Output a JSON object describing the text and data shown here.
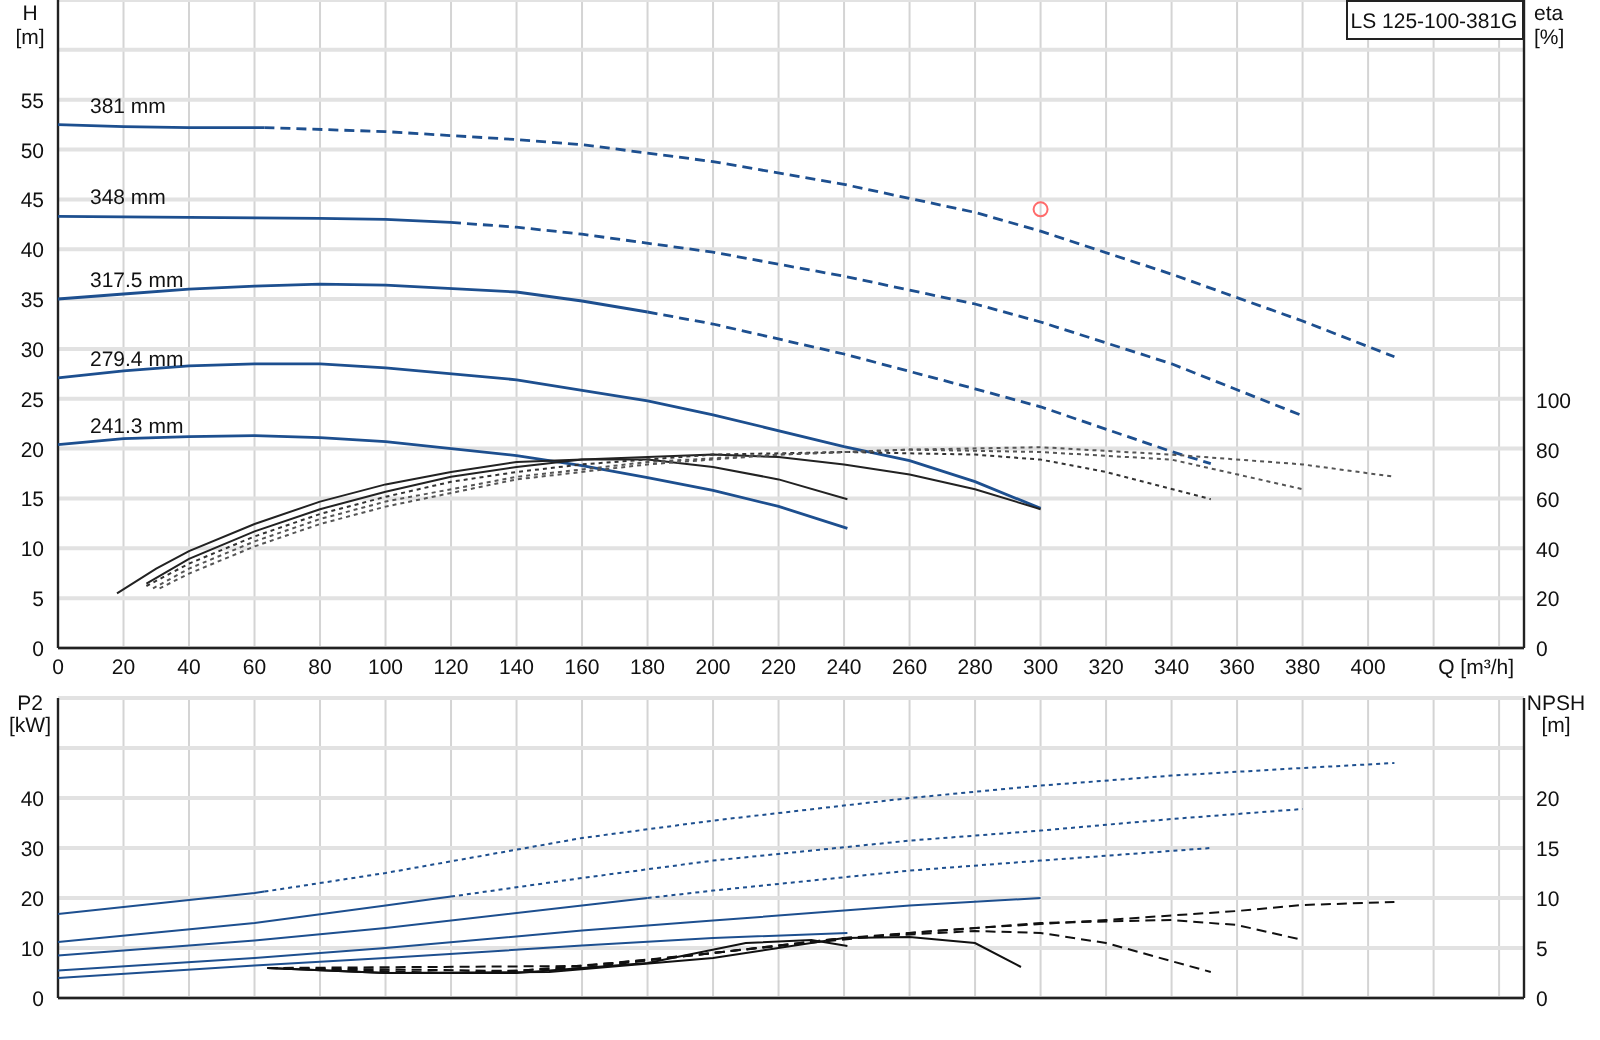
{
  "model_label": "LS 125-100-381G",
  "head_chart": {
    "chart_data": {
      "type": "line",
      "xlabel": "Q [m³/h]",
      "ylabel": "H\n[m]",
      "grid": true,
      "xlim": [
        0,
        447.6
      ],
      "ylim": [
        0,
        65
      ],
      "xticks": [
        0,
        20,
        40,
        60,
        80,
        100,
        120,
        140,
        160,
        180,
        200,
        220,
        240,
        260,
        280,
        300,
        320,
        340,
        360,
        380,
        400
      ],
      "yticks": [
        0,
        5,
        10,
        15,
        20,
        25,
        30,
        35,
        40,
        45,
        50,
        55
      ],
      "series": [
        {
          "name": "381 mm",
          "color": "#1d4f8f",
          "line_style": "solid",
          "x": [
            0,
            20,
            40,
            63
          ],
          "values": [
            52.5,
            52.3,
            52.2,
            52.2
          ]
        },
        {
          "color": "#1d4f8f",
          "line_style": "dashed",
          "x": [
            63,
            100,
            140,
            160,
            200,
            240,
            280,
            300,
            340,
            380,
            408
          ],
          "values": [
            52.2,
            51.8,
            51,
            50.5,
            48.8,
            46.5,
            43.7,
            41.8,
            37.5,
            32.8,
            29.2
          ]
        },
        {
          "name": "348 mm",
          "color": "#1d4f8f",
          "line_style": "solid",
          "x": [
            0,
            40,
            80,
            100,
            120
          ],
          "values": [
            43.3,
            43.2,
            43.1,
            43,
            42.7
          ]
        },
        {
          "color": "#1d4f8f",
          "line_style": "dashed",
          "x": [
            120,
            140,
            160,
            200,
            240,
            280,
            300,
            340,
            380
          ],
          "values": [
            42.7,
            42.2,
            41.5,
            39.7,
            37.3,
            34.5,
            32.7,
            28.5,
            23.3
          ]
        },
        {
          "name": "317.5 mm",
          "color": "#1d4f8f",
          "line_style": "solid",
          "x": [
            0,
            20,
            40,
            60,
            80,
            100,
            140,
            160,
            180
          ],
          "values": [
            35,
            35.5,
            36,
            36.3,
            36.5,
            36.4,
            35.7,
            34.8,
            33.7
          ]
        },
        {
          "color": "#1d4f8f",
          "line_style": "dashed",
          "x": [
            180,
            200,
            240,
            280,
            300,
            340,
            352
          ],
          "values": [
            33.7,
            32.5,
            29.5,
            26,
            24.2,
            19.7,
            18.5
          ]
        },
        {
          "name": "279.4 mm",
          "color": "#1d4f8f",
          "line_style": "solid",
          "x": [
            0,
            20,
            40,
            60,
            80,
            100,
            140,
            180,
            200,
            240,
            260,
            280,
            300
          ],
          "values": [
            27.1,
            27.8,
            28.3,
            28.5,
            28.5,
            28.1,
            26.9,
            24.8,
            23.4,
            20.2,
            18.8,
            16.7,
            14
          ]
        },
        {
          "name": "241.3 mm",
          "color": "#1d4f8f",
          "line_style": "solid",
          "x": [
            0,
            20,
            40,
            60,
            80,
            100,
            140,
            160,
            180,
            200,
            220,
            241
          ],
          "values": [
            20.4,
            21,
            21.2,
            21.3,
            21.1,
            20.7,
            19.3,
            18.3,
            17.1,
            15.8,
            14.2,
            12
          ]
        },
        {
          "color": "#ff6b6b",
          "marker": "circle",
          "x": [
            300
          ],
          "values": [
            44
          ]
        }
      ]
    }
  },
  "efficiency_chart": {
    "chart_data": {
      "type": "line",
      "ylabel": "eta\n[%]",
      "xlim": [
        0,
        447.6
      ],
      "ylim": [
        0,
        261.3
      ],
      "yticks": [
        0,
        20,
        40,
        60,
        80,
        100
      ],
      "series": [
        {
          "color": "#222222",
          "line_style": "solid",
          "x": [
            18,
            30,
            40,
            60,
            80,
            100,
            120,
            140,
            160,
            180,
            200,
            220,
            241
          ],
          "values": [
            22,
            32,
            39,
            50,
            59,
            66,
            71,
            75,
            76,
            76,
            73,
            68,
            60
          ]
        },
        {
          "color": "#222222",
          "line_style": "solid",
          "x": [
            27,
            40,
            60,
            80,
            100,
            120,
            140,
            160,
            180,
            200,
            220,
            240,
            260,
            280,
            300
          ],
          "values": [
            26,
            36,
            47,
            56,
            63,
            69,
            73,
            76,
            77,
            78,
            77,
            74,
            70,
            64,
            56
          ]
        },
        {
          "color": "#333333",
          "line_style": "dotted",
          "x": [
            27,
            40,
            60,
            80,
            100,
            120,
            140,
            160,
            200,
            240,
            280,
            300,
            320,
            352
          ],
          "values": [
            25,
            34,
            45,
            54,
            61,
            67,
            71,
            74,
            78,
            79,
            78,
            76,
            71,
            60
          ]
        },
        {
          "color": "#555555",
          "line_style": "dotted",
          "x": [
            29,
            40,
            60,
            80,
            100,
            140,
            180,
            220,
            260,
            300,
            340,
            380
          ],
          "values": [
            24,
            32,
            43,
            52,
            59,
            69,
            75,
            78,
            80,
            79,
            76,
            64
          ]
        },
        {
          "color": "#555555",
          "line_style": "dotted",
          "x": [
            31,
            40,
            60,
            80,
            100,
            140,
            180,
            220,
            260,
            300,
            340,
            380,
            408
          ],
          "values": [
            24,
            30,
            41,
            50,
            57,
            68,
            74,
            78,
            80,
            81,
            78,
            74,
            69
          ]
        }
      ]
    }
  },
  "power_chart": {
    "chart_data": {
      "type": "line",
      "ylabel": "P2\n[kW]",
      "grid": true,
      "xlim": [
        0,
        447.6
      ],
      "ylim": [
        0,
        60
      ],
      "yticks": [
        0,
        10,
        20,
        30,
        40
      ],
      "series": [
        {
          "color": "#1d4f8f",
          "line_style": "solid",
          "x": [
            0,
            60,
            63
          ],
          "values": [
            16.8,
            21,
            21.3
          ]
        },
        {
          "color": "#1d4f8f",
          "line_style": "dotted",
          "x": [
            63,
            100,
            160,
            200,
            260,
            300,
            340,
            380,
            408
          ],
          "values": [
            21.3,
            25,
            32,
            35.5,
            40,
            42.5,
            44.5,
            46,
            47
          ]
        },
        {
          "color": "#1d4f8f",
          "line_style": "solid",
          "x": [
            0,
            60,
            100,
            120
          ],
          "values": [
            11.2,
            15,
            18.5,
            20.3
          ]
        },
        {
          "color": "#1d4f8f",
          "line_style": "dotted",
          "x": [
            120,
            160,
            200,
            260,
            300,
            340,
            380
          ],
          "values": [
            20.3,
            24,
            27.5,
            31.5,
            33.5,
            35.8,
            37.8
          ]
        },
        {
          "color": "#1d4f8f",
          "line_style": "solid",
          "x": [
            0,
            60,
            100,
            160,
            180
          ],
          "values": [
            8.5,
            11.5,
            14,
            18.5,
            20
          ]
        },
        {
          "color": "#1d4f8f",
          "line_style": "dotted",
          "x": [
            180,
            200,
            260,
            300,
            352
          ],
          "values": [
            20,
            21.5,
            25.5,
            27.5,
            30
          ]
        },
        {
          "color": "#1d4f8f",
          "line_style": "solid",
          "x": [
            0,
            60,
            100,
            160,
            200,
            260,
            300
          ],
          "values": [
            5.5,
            8,
            10,
            13.5,
            15.5,
            18.5,
            20
          ]
        },
        {
          "color": "#1d4f8f",
          "line_style": "solid",
          "x": [
            0,
            60,
            100,
            160,
            200,
            241
          ],
          "values": [
            4,
            6.5,
            8,
            10.5,
            12,
            13
          ]
        }
      ]
    }
  },
  "npsh_chart": {
    "chart_data": {
      "type": "line",
      "ylabel": "NPSH\n[m]",
      "xlim": [
        0,
        447.6
      ],
      "ylim": [
        0,
        30
      ],
      "yticks": [
        0,
        5,
        10,
        15,
        20
      ],
      "series": [
        {
          "color": "#111111",
          "line_style": "solid",
          "x": [
            64,
            100,
            140,
            180,
            210,
            230,
            241
          ],
          "values": [
            3,
            2.5,
            2.5,
            3.5,
            5.5,
            5.8,
            5.2
          ]
        },
        {
          "color": "#111111",
          "line_style": "solid",
          "x": [
            64,
            100,
            150,
            200,
            240,
            260,
            280,
            294
          ],
          "values": [
            3,
            2.5,
            2.6,
            4,
            6,
            6.1,
            5.5,
            3.1
          ]
        },
        {
          "color": "#111111",
          "line_style": "dashed",
          "x": [
            64,
            120,
            160,
            200,
            240,
            280,
            300,
            320,
            352
          ],
          "values": [
            3,
            2.5,
            3,
            4.5,
            6,
            6.7,
            6.5,
            5.5,
            2.6
          ]
        },
        {
          "color": "#111111",
          "line_style": "dashed",
          "x": [
            64,
            140,
            180,
            220,
            260,
            300,
            340,
            360,
            380
          ],
          "values": [
            3,
            2.7,
            3.8,
            5.2,
            6.5,
            7.5,
            7.8,
            7.3,
            5.8
          ]
        },
        {
          "color": "#111111",
          "line_style": "dashed",
          "x": [
            64,
            160,
            200,
            240,
            280,
            320,
            360,
            380,
            408
          ],
          "values": [
            3,
            3.2,
            4.5,
            6,
            7,
            7.8,
            8.7,
            9.3,
            9.6
          ]
        }
      ]
    }
  }
}
